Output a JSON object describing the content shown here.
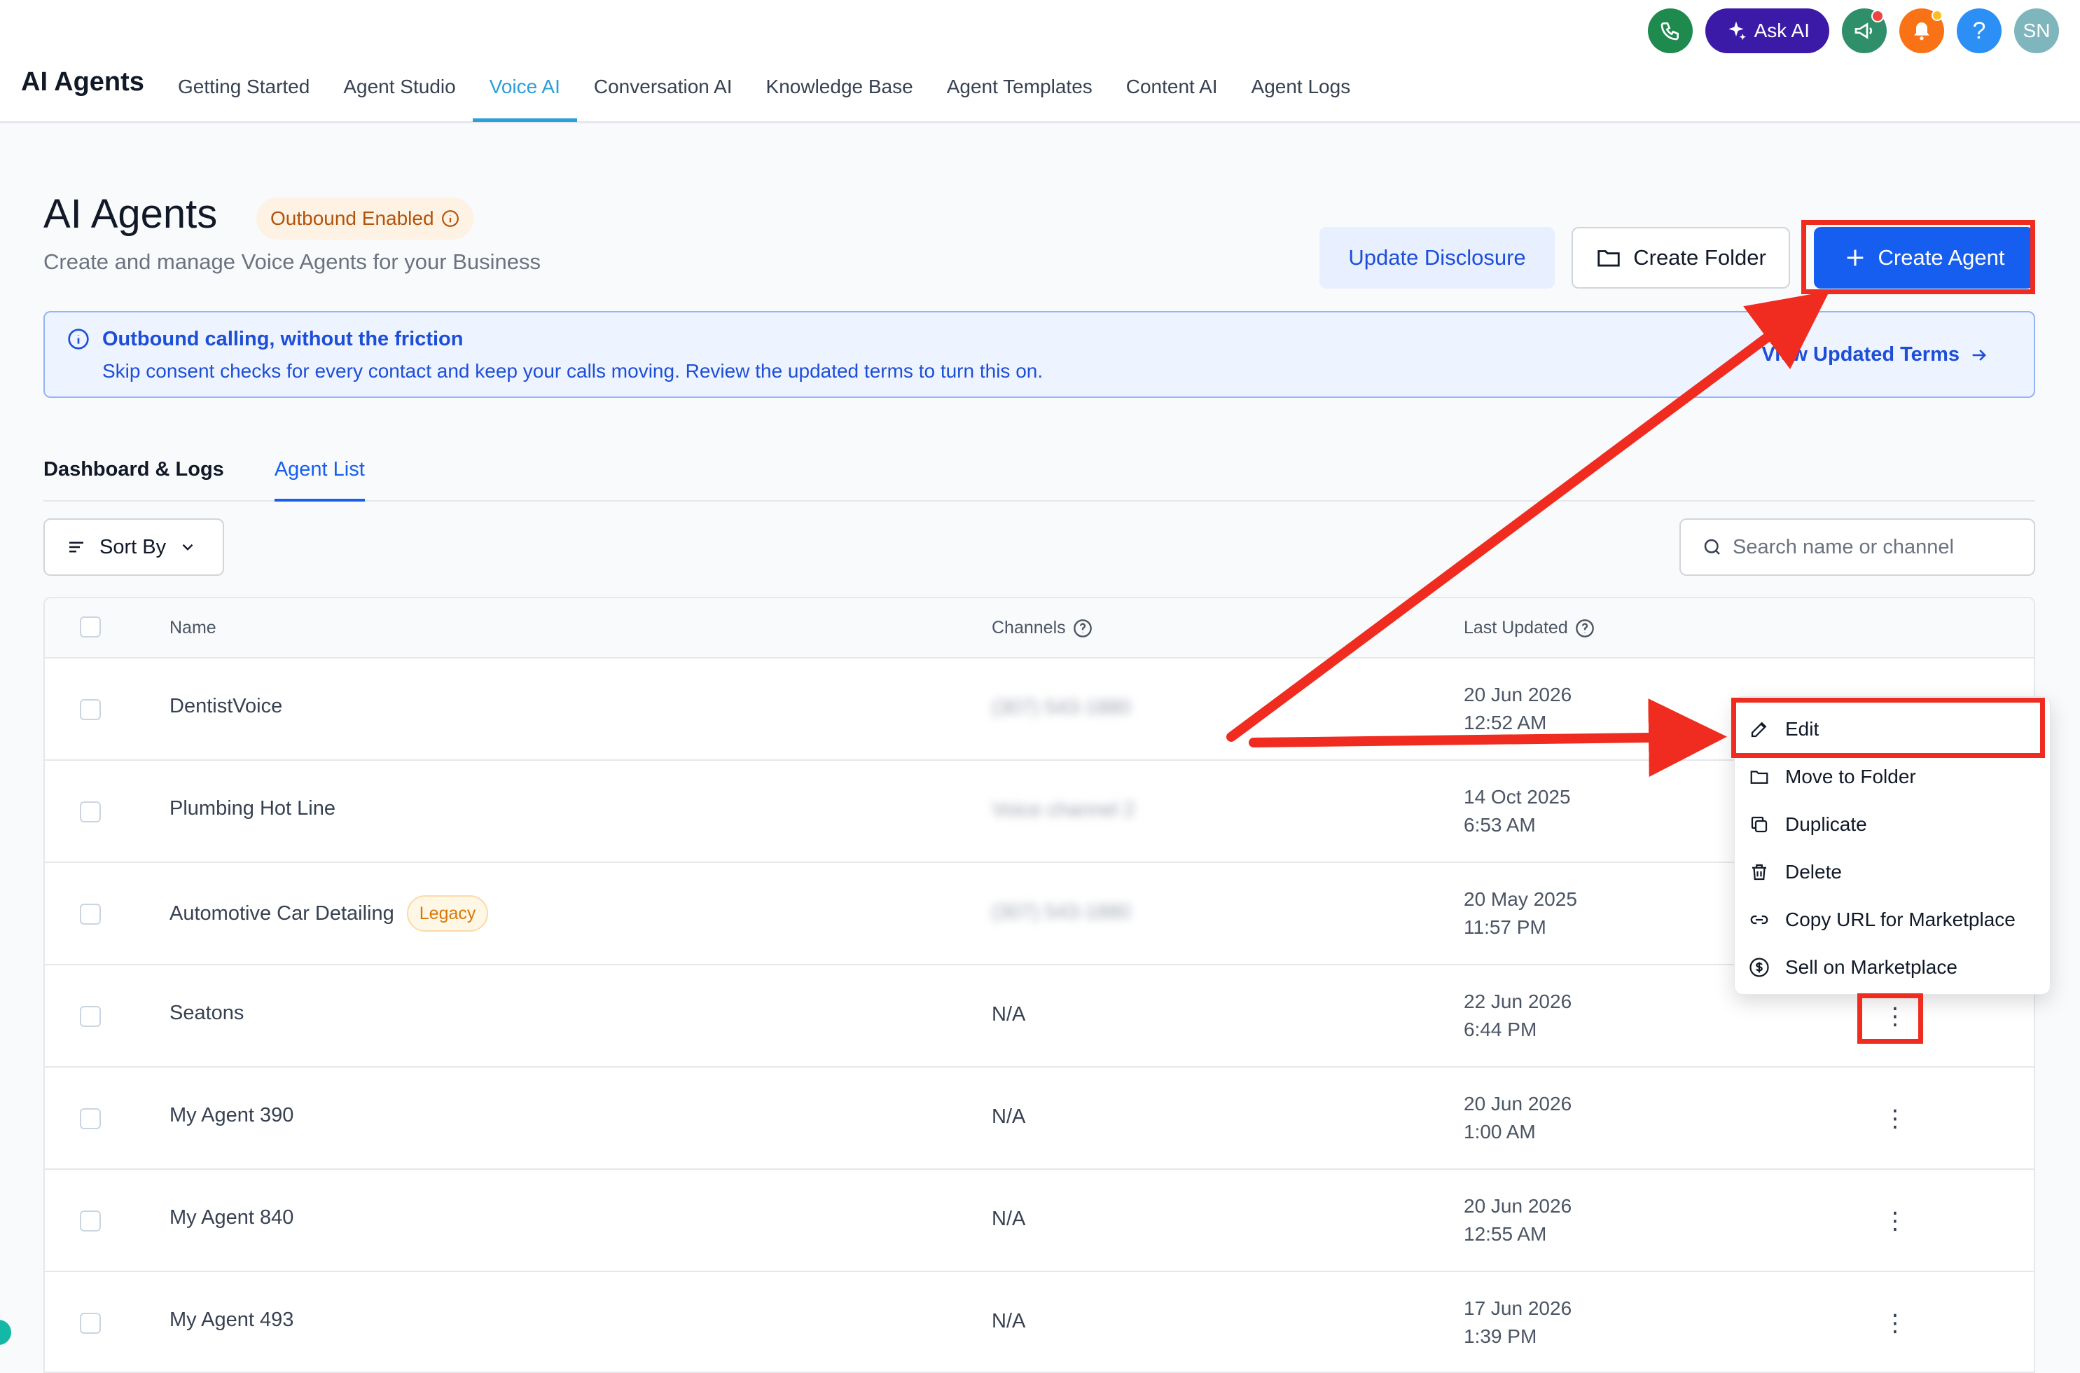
{
  "app": {
    "title": "AI Agents"
  },
  "nav": {
    "tabs": [
      {
        "label": "Getting Started"
      },
      {
        "label": "Agent Studio"
      },
      {
        "label": "Voice AI"
      },
      {
        "label": "Conversation AI"
      },
      {
        "label": "Knowledge Base"
      },
      {
        "label": "Agent Templates"
      },
      {
        "label": "Content AI"
      },
      {
        "label": "Agent Logs"
      }
    ],
    "active_tab": "Voice AI"
  },
  "topbar": {
    "ask_ai_label": "Ask AI",
    "help_label": "?",
    "avatar_initials": "SN",
    "colors": {
      "phone": "#1e8a4e",
      "ask_ai": "#3b1aa8",
      "announce": "#2f8f6b",
      "bell": "#f97316",
      "help": "#2b8ff5",
      "avatar": "#7fb6bd"
    }
  },
  "header": {
    "title": "AI Agents",
    "badge": "Outbound Enabled",
    "subtitle": "Create and manage Voice Agents for your Business",
    "update_disclosure": "Update Disclosure",
    "create_folder": "Create Folder",
    "create_agent": "Create Agent"
  },
  "banner": {
    "title": "Outbound calling, without the friction",
    "text": "Skip consent checks for every contact and keep your calls moving. Review the updated terms to turn this on.",
    "link": "View Updated Terms"
  },
  "sub_tabs": [
    {
      "label": "Dashboard & Logs"
    },
    {
      "label": "Agent List"
    }
  ],
  "controls": {
    "sort_label": "Sort By",
    "search_placeholder": "Search name or channel"
  },
  "table": {
    "columns": {
      "name": "Name",
      "channels": "Channels",
      "last_updated": "Last Updated"
    },
    "rows": [
      {
        "name": "DentistVoice",
        "channel": "(307) 543-1880",
        "date": "20 Jun 2026",
        "time": "12:52 AM",
        "badge": ""
      },
      {
        "name": "Plumbing Hot Line",
        "channel": "Voice channel 2",
        "date": "14 Oct 2025",
        "time": "6:53 AM",
        "badge": ""
      },
      {
        "name": "Automotive Car Detailing",
        "channel": "(307) 543-1880",
        "date": "20 May 2025",
        "time": "11:57 PM",
        "badge": "Legacy"
      },
      {
        "name": "Seatons",
        "channel": "N/A",
        "date": "22 Jun 2026",
        "time": "6:44 PM",
        "badge": ""
      },
      {
        "name": "My Agent 390",
        "channel": "N/A",
        "date": "20 Jun 2026",
        "time": "1:00 AM",
        "badge": ""
      },
      {
        "name": "My Agent 840",
        "channel": "N/A",
        "date": "20 Jun 2026",
        "time": "12:55 AM",
        "badge": ""
      },
      {
        "name": "My Agent 493",
        "channel": "N/A",
        "date": "17 Jun 2026",
        "time": "1:39 PM",
        "badge": ""
      }
    ]
  },
  "menu": {
    "items": [
      {
        "label": "Edit",
        "icon": "pencil-icon"
      },
      {
        "label": "Move to Folder",
        "icon": "folder-icon"
      },
      {
        "label": "Duplicate",
        "icon": "copy-icon"
      },
      {
        "label": "Delete",
        "icon": "trash-icon"
      },
      {
        "label": "Copy URL for Marketplace",
        "icon": "link-icon"
      },
      {
        "label": "Sell on Marketplace",
        "icon": "dollar-circle-icon"
      }
    ]
  },
  "annotation_color": "#ef2c1f"
}
